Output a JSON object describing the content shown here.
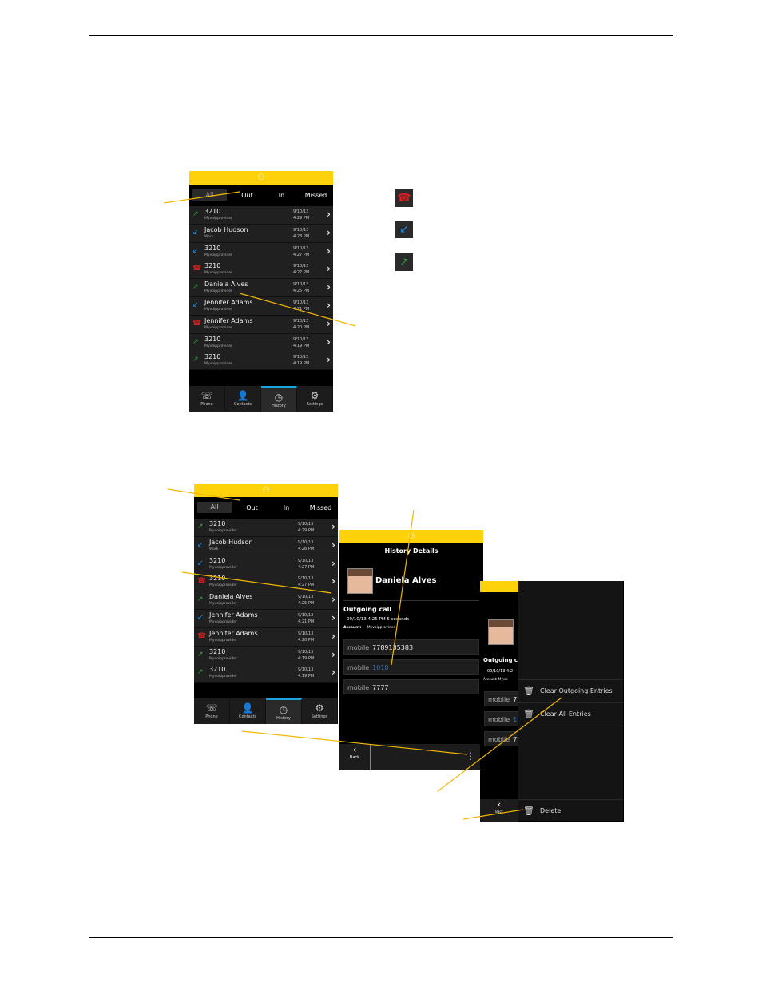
{
  "colors": {
    "accent": "#fdd20a",
    "callout": "#f2b705",
    "outgoing": "#2ea043",
    "incoming": "#1a8fe0",
    "missed": "#d42020",
    "active_tab": "#1aa6dd"
  },
  "status_icon": "bbm-style-icon",
  "call_log": {
    "tabs": [
      "All",
      "Out",
      "In",
      "Missed"
    ],
    "rows": [
      {
        "name": "3210",
        "sub": "Myvoipprovider",
        "date": "9/10/13",
        "time": "4:29 PM",
        "type": "outgoing"
      },
      {
        "name": "Jacob Hudson",
        "sub": "Work",
        "date": "9/10/13",
        "time": "4:28 PM",
        "type": "incoming"
      },
      {
        "name": "3210",
        "sub": "Myvoipprovider",
        "date": "9/10/13",
        "time": "4:27 PM",
        "type": "incoming"
      },
      {
        "name": "3210",
        "sub": "Myvoipprovider",
        "date": "9/10/13",
        "time": "4:27 PM",
        "type": "missed"
      },
      {
        "name": "Daniela Alves",
        "sub": "Myvoipprovider",
        "date": "9/10/13",
        "time": "4:25 PM",
        "type": "outgoing"
      },
      {
        "name": "Jennifer Adams",
        "sub": "Myvoipprovider",
        "date": "9/10/13",
        "time": "4:21 PM",
        "type": "incoming"
      },
      {
        "name": "Jennifer Adams",
        "sub": "Myvoipprovider",
        "date": "9/10/13",
        "time": "4:20 PM",
        "type": "missed"
      },
      {
        "name": "3210",
        "sub": "Myvoipprovider",
        "date": "9/10/13",
        "time": "4:19 PM",
        "type": "outgoing"
      },
      {
        "name": "3210",
        "sub": "Myvoipprovider",
        "date": "9/10/13",
        "time": "4:19 PM",
        "type": "outgoing"
      }
    ],
    "nav": [
      {
        "label": "Phone",
        "icon": "phone-icon"
      },
      {
        "label": "Contacts",
        "icon": "contact-icon"
      },
      {
        "label": "History",
        "icon": "clock-icon"
      },
      {
        "label": "Settings",
        "icon": "gear-icon"
      }
    ]
  },
  "details": {
    "title": "History Details",
    "contact": "Daniela Alves",
    "call_type": "Outgoing call",
    "call_info": "09/10/13 4:25 PM  5 seconds",
    "account_label": "Account:",
    "account_value": "Myvoipprovider",
    "numbers": [
      {
        "label": "mobile",
        "value": "7789135383"
      },
      {
        "label": "mobile",
        "value": "1018"
      },
      {
        "label": "mobile",
        "value": "7777"
      }
    ],
    "back": "Back",
    "overflow_icon": "more-vertical-icon"
  },
  "menu": {
    "items": [
      "Clear Outgoing Entries",
      "Clear All Entries"
    ],
    "delete": "Delete",
    "partial_call_type": "Outgoing c",
    "partial_call_info": "09/10/13 4:2",
    "partial_account": "Account:  Myvoi",
    "partial_numbers": [
      "77",
      "10",
      "77"
    ]
  }
}
